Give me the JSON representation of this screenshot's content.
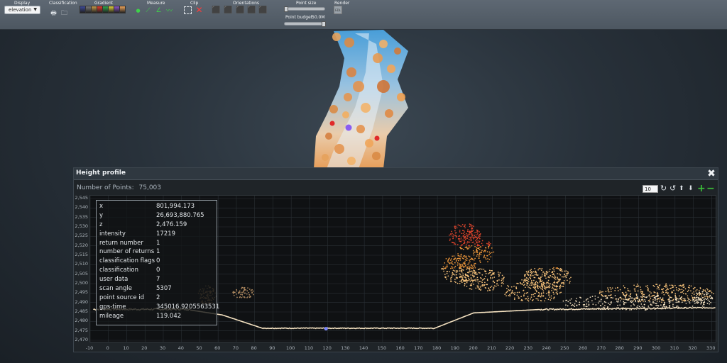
{
  "toolbar": {
    "sections": {
      "display": "Display",
      "classification": "Classification",
      "gradient": "Gradient",
      "measure": "Measure",
      "clip": "Clip",
      "orientations": "Orientations",
      "point_size": "Point size",
      "render": "Render"
    },
    "display_value": "elevation",
    "point_budget_label": "Point budget",
    "point_budget_value": "50.0M",
    "render_button_text": "EDL",
    "point_size_level": 0.05,
    "point_budget_level": 0.97,
    "gradient_swatches": [
      "#3c4a9a",
      "#7a7a7a",
      "#c79b4a",
      "#e23b2b",
      "#2fa84f",
      "#e0d23a",
      "#8a56c8",
      "#f0a55a"
    ],
    "icons": [
      "print-icon",
      "folder-icon",
      "point-measure-icon",
      "distance-measure-icon",
      "angle-measure-icon",
      "profile-measure-icon",
      "clip-box-icon",
      "clip-remove-icon",
      "top-view-icon",
      "front-view-icon",
      "left-view-icon",
      "right-view-icon",
      "back-view-icon"
    ]
  },
  "profile": {
    "title": "Height profile",
    "points_label": "Number of Points:",
    "points_value": "75,003",
    "zoom_value": "10",
    "y_ticks": [
      "2,545",
      "2,540",
      "2,535",
      "2,530",
      "2,525",
      "2,520",
      "2,515",
      "2,510",
      "2,505",
      "2,500",
      "2,495",
      "2,490",
      "2,485",
      "2,480",
      "2,475",
      "2,470"
    ],
    "x_ticks": [
      "-10",
      "0",
      "10",
      "20",
      "30",
      "40",
      "50",
      "60",
      "70",
      "80",
      "90",
      "100",
      "110",
      "120",
      "130",
      "140",
      "150",
      "160",
      "170",
      "180",
      "190",
      "200",
      "210",
      "220",
      "230",
      "240",
      "250",
      "260",
      "270",
      "280",
      "290",
      "300",
      "310",
      "320",
      "330"
    ],
    "info": [
      {
        "key": "x",
        "value": "801,994.173"
      },
      {
        "key": "y",
        "value": "26,693,880.765"
      },
      {
        "key": "z",
        "value": "2,476.159"
      },
      {
        "key": "intensity",
        "value": "17219"
      },
      {
        "key": "return number",
        "value": "1"
      },
      {
        "key": "number of returns",
        "value": "1"
      },
      {
        "key": "classification flags",
        "value": "0"
      },
      {
        "key": "classification",
        "value": "0"
      },
      {
        "key": "user data",
        "value": "7"
      },
      {
        "key": "scan angle",
        "value": "5307"
      },
      {
        "key": "point source id",
        "value": "2"
      },
      {
        "key": "gps-time",
        "value": "345016.9205563531"
      },
      {
        "key": "mileage",
        "value": "119.042"
      }
    ]
  },
  "colors": {
    "ground": "#f6e3c2",
    "trees_high": "#e0452c",
    "trees_mid": "#f39a3c",
    "trees_low": "#f7c27a",
    "selected_point": "#7a86ff",
    "accent_green": "#3cc13a"
  }
}
